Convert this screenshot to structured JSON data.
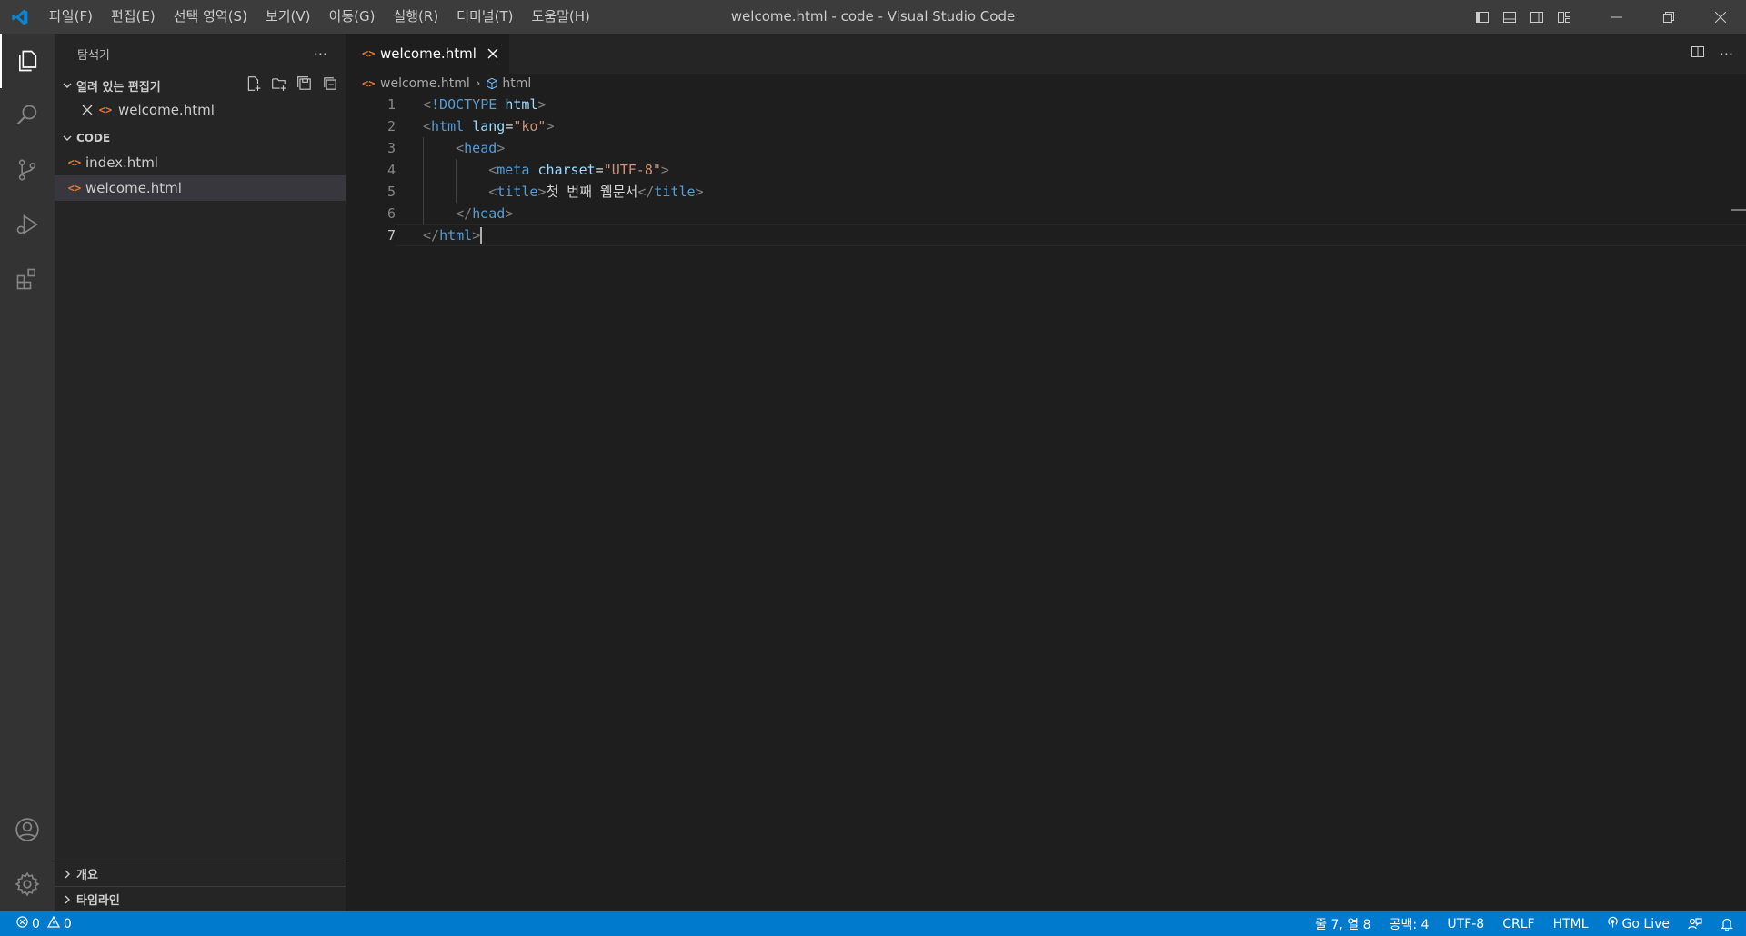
{
  "window": {
    "title": "welcome.html - code - Visual Studio Code"
  },
  "menu": [
    "파일(F)",
    "편집(E)",
    "선택 영역(S)",
    "보기(V)",
    "이동(G)",
    "실행(R)",
    "터미널(T)",
    "도움말(H)"
  ],
  "sidebar": {
    "title": "탐색기",
    "open_editors": {
      "label": "열려 있는 편집기",
      "files": [
        "welcome.html"
      ]
    },
    "folder": {
      "label": "CODE",
      "files": [
        "index.html",
        "welcome.html"
      ]
    },
    "outline_label": "개요",
    "timeline_label": "타임라인"
  },
  "editor": {
    "tab_label": "welcome.html",
    "breadcrumb": {
      "file": "welcome.html",
      "symbol": "html"
    },
    "line_numbers": [
      "1",
      "2",
      "3",
      "4",
      "5",
      "6",
      "7"
    ],
    "current_line": 7,
    "lines": [
      {
        "indent": "",
        "parts": [
          [
            "brk",
            "<"
          ],
          [
            "doc",
            "!DOCTYPE"
          ],
          [
            "txt",
            " "
          ],
          [
            "attr",
            "html"
          ],
          [
            "brk",
            ">"
          ]
        ]
      },
      {
        "indent": "",
        "parts": [
          [
            "brk",
            "<"
          ],
          [
            "tag",
            "html"
          ],
          [
            "txt",
            " "
          ],
          [
            "attr",
            "lang"
          ],
          [
            "txt",
            "="
          ],
          [
            "str",
            "\"ko\""
          ],
          [
            "brk",
            ">"
          ]
        ]
      },
      {
        "indent": "    ",
        "parts": [
          [
            "brk",
            "<"
          ],
          [
            "tag",
            "head"
          ],
          [
            "brk",
            ">"
          ]
        ]
      },
      {
        "indent": "        ",
        "parts": [
          [
            "brk",
            "<"
          ],
          [
            "tag",
            "meta"
          ],
          [
            "txt",
            " "
          ],
          [
            "attr",
            "charset"
          ],
          [
            "txt",
            "="
          ],
          [
            "str",
            "\"UTF-8\""
          ],
          [
            "brk",
            ">"
          ]
        ]
      },
      {
        "indent": "        ",
        "parts": [
          [
            "brk",
            "<"
          ],
          [
            "tag",
            "title"
          ],
          [
            "brk",
            ">"
          ],
          [
            "txt",
            "첫 번째 웹문서"
          ],
          [
            "brk",
            "</"
          ],
          [
            "tag",
            "title"
          ],
          [
            "brk",
            ">"
          ]
        ]
      },
      {
        "indent": "    ",
        "parts": [
          [
            "brk",
            "</"
          ],
          [
            "tag",
            "head"
          ],
          [
            "brk",
            ">"
          ]
        ]
      },
      {
        "indent": "",
        "parts": [
          [
            "brk",
            "</"
          ],
          [
            "tag",
            "html"
          ],
          [
            "brk",
            ">"
          ]
        ]
      }
    ]
  },
  "status": {
    "errors": "0",
    "warnings": "0",
    "position": "줄 7, 열 8",
    "spaces": "공백: 4",
    "encoding": "UTF-8",
    "eol": "CRLF",
    "language": "HTML",
    "golive": "Go Live"
  },
  "colors": {
    "accent": "#007acc",
    "file_icon": "#e37933"
  }
}
